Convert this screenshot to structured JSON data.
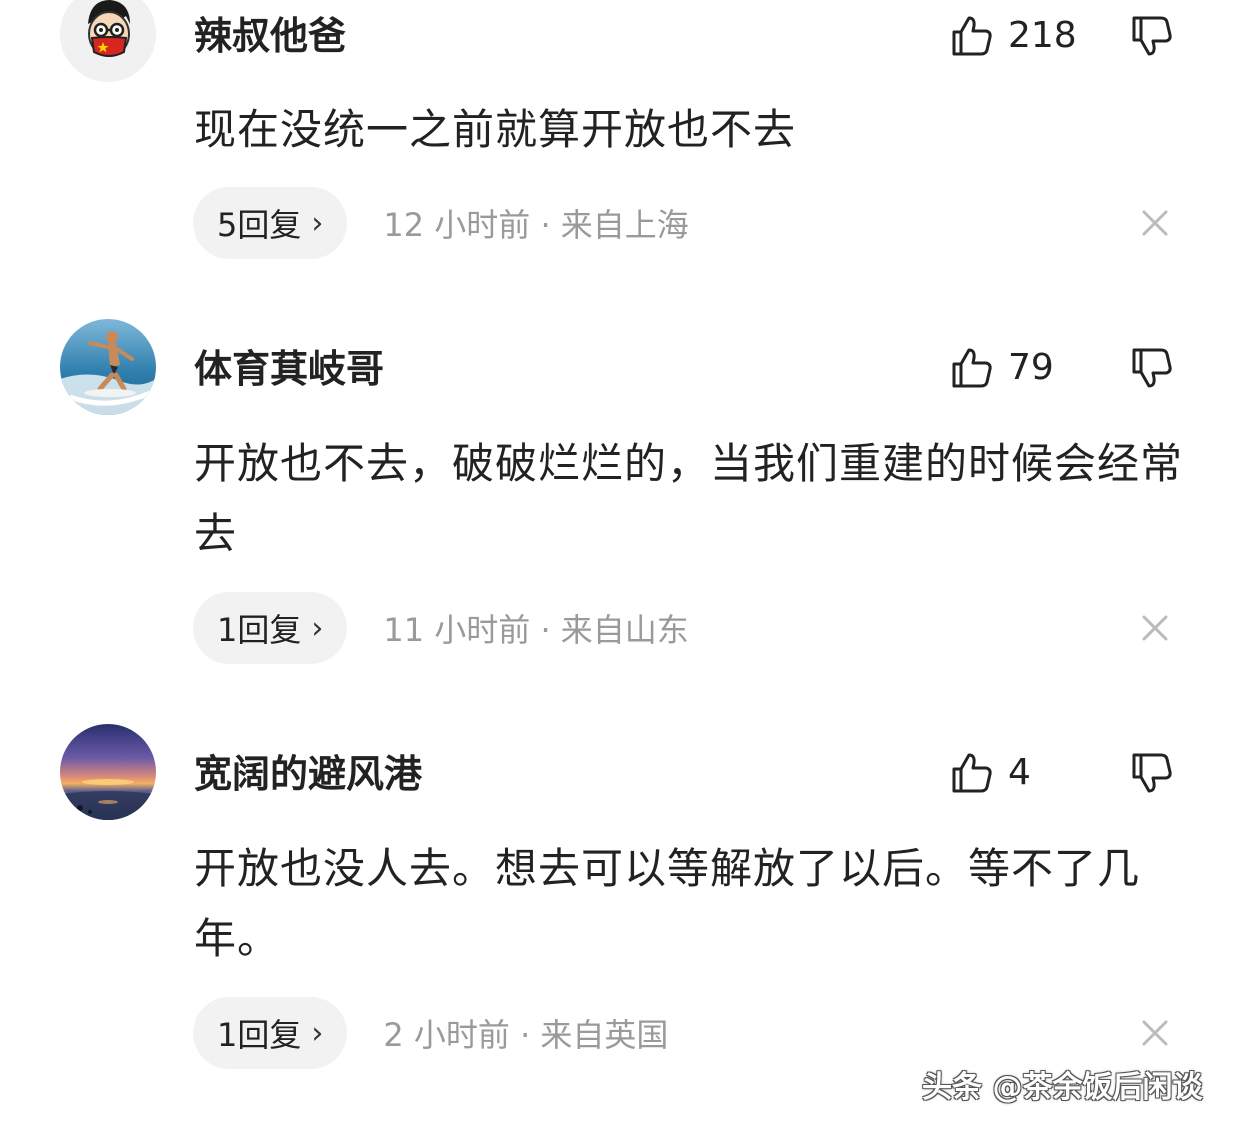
{
  "comments": [
    {
      "username": "辣叔他爸",
      "avatar_icon": "cartoon-face-with-flag-mask-avatar",
      "likes": "218",
      "text": "现在没统一之前就算开放也不去",
      "replies_label": "5回复",
      "meta": "12 小时前 · 来自上海"
    },
    {
      "username": "体育萁岐哥",
      "avatar_icon": "surfer-photo-avatar",
      "likes": "79",
      "text": "开放也不去，破破烂烂的，当我们重建的时候会经常去",
      "replies_label": "1回复",
      "meta": "11 小时前 · 来自山东"
    },
    {
      "username": "宽阔的避风港",
      "avatar_icon": "sunset-sea-photo-avatar",
      "likes": "4",
      "text": "开放也没人去。想去可以等解放了以后。等不了几年。",
      "replies_label": "1回复",
      "meta": "2 小时前 · 来自英国"
    }
  ],
  "icons": {
    "like": "thumbs-up-icon",
    "dislike": "thumbs-down-icon",
    "reply_chevron": "chevron-right-icon",
    "close": "close-icon"
  },
  "reply_chevron_glyph": "›",
  "watermark": "头条 @茶余饭后闲谈",
  "colors": {
    "text": "#222222",
    "meta": "#9a9a9a",
    "pill_bg": "#f2f2f2",
    "close": "#bbbbbb"
  }
}
